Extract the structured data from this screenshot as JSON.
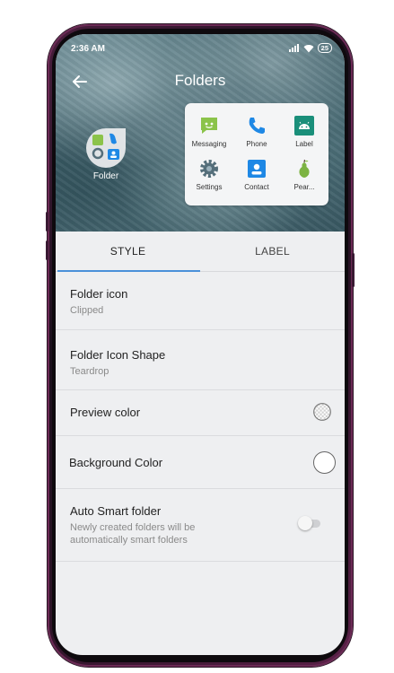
{
  "status_bar": {
    "time": "2:36 AM",
    "battery": "25"
  },
  "header": {
    "title": "Folders",
    "back_icon": "back-arrow-icon"
  },
  "folder_preview": {
    "label": "Folder"
  },
  "folder_apps": [
    {
      "label": "Messaging",
      "icon": "messaging-icon",
      "color": "#8bc34a"
    },
    {
      "label": "Phone",
      "icon": "phone-icon",
      "color": "#1e88e5"
    },
    {
      "label": "Label",
      "icon": "android-icon",
      "color": "#1a8f7a"
    },
    {
      "label": "Settings",
      "icon": "settings-gear-icon",
      "color": "#546e7a"
    },
    {
      "label": "Contact",
      "icon": "contact-icon",
      "color": "#1e88e5"
    },
    {
      "label": "Pear...",
      "icon": "pear-icon",
      "color": "#7cb342"
    }
  ],
  "tabs": [
    {
      "label": "STYLE",
      "active": true
    },
    {
      "label": "LABEL",
      "active": false
    }
  ],
  "settings": {
    "folder_icon": {
      "title": "Folder icon",
      "value": "Clipped"
    },
    "folder_icon_shape": {
      "title": "Folder Icon Shape",
      "value": "Teardrop"
    },
    "preview_color": {
      "title": "Preview color"
    },
    "background_color": {
      "title": "Background Color"
    },
    "auto_smart_folder": {
      "title": "Auto Smart folder",
      "subtitle_line1": "Newly created folders will be",
      "subtitle_line2": "automatically smart folders",
      "enabled": false
    }
  },
  "colors": {
    "accent": "#4a90d9",
    "text_primary": "#222222",
    "text_secondary": "#8a8a8a"
  }
}
